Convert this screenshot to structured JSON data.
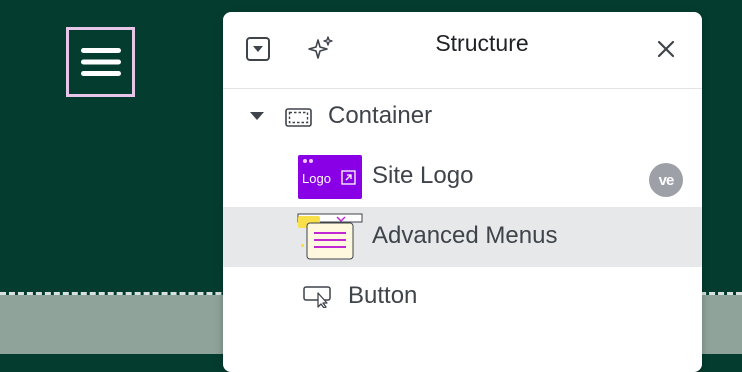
{
  "panel": {
    "title": "Structure"
  },
  "tree": {
    "container_label": "Container",
    "site_logo_label": "Site Logo",
    "site_logo_thumb_text": "Logo",
    "site_logo_badge": "ve",
    "advanced_menus_label": "Advanced Menus",
    "button_label": "Button"
  },
  "icons": {
    "menu": "hamburger-icon",
    "collapse": "square-chevron-down-icon",
    "ai": "sparkles-icon",
    "close": "close-icon",
    "caret": "caret-down-icon",
    "container": "container-dashed-icon",
    "button": "button-cursor-icon"
  },
  "colors": {
    "canvas_bg": "#043d2f",
    "selection_outline": "#e7c6ea",
    "logo_thumb": "#8a00e6",
    "row_selected": "#e6e8ea",
    "badge": "#9da0a6"
  }
}
